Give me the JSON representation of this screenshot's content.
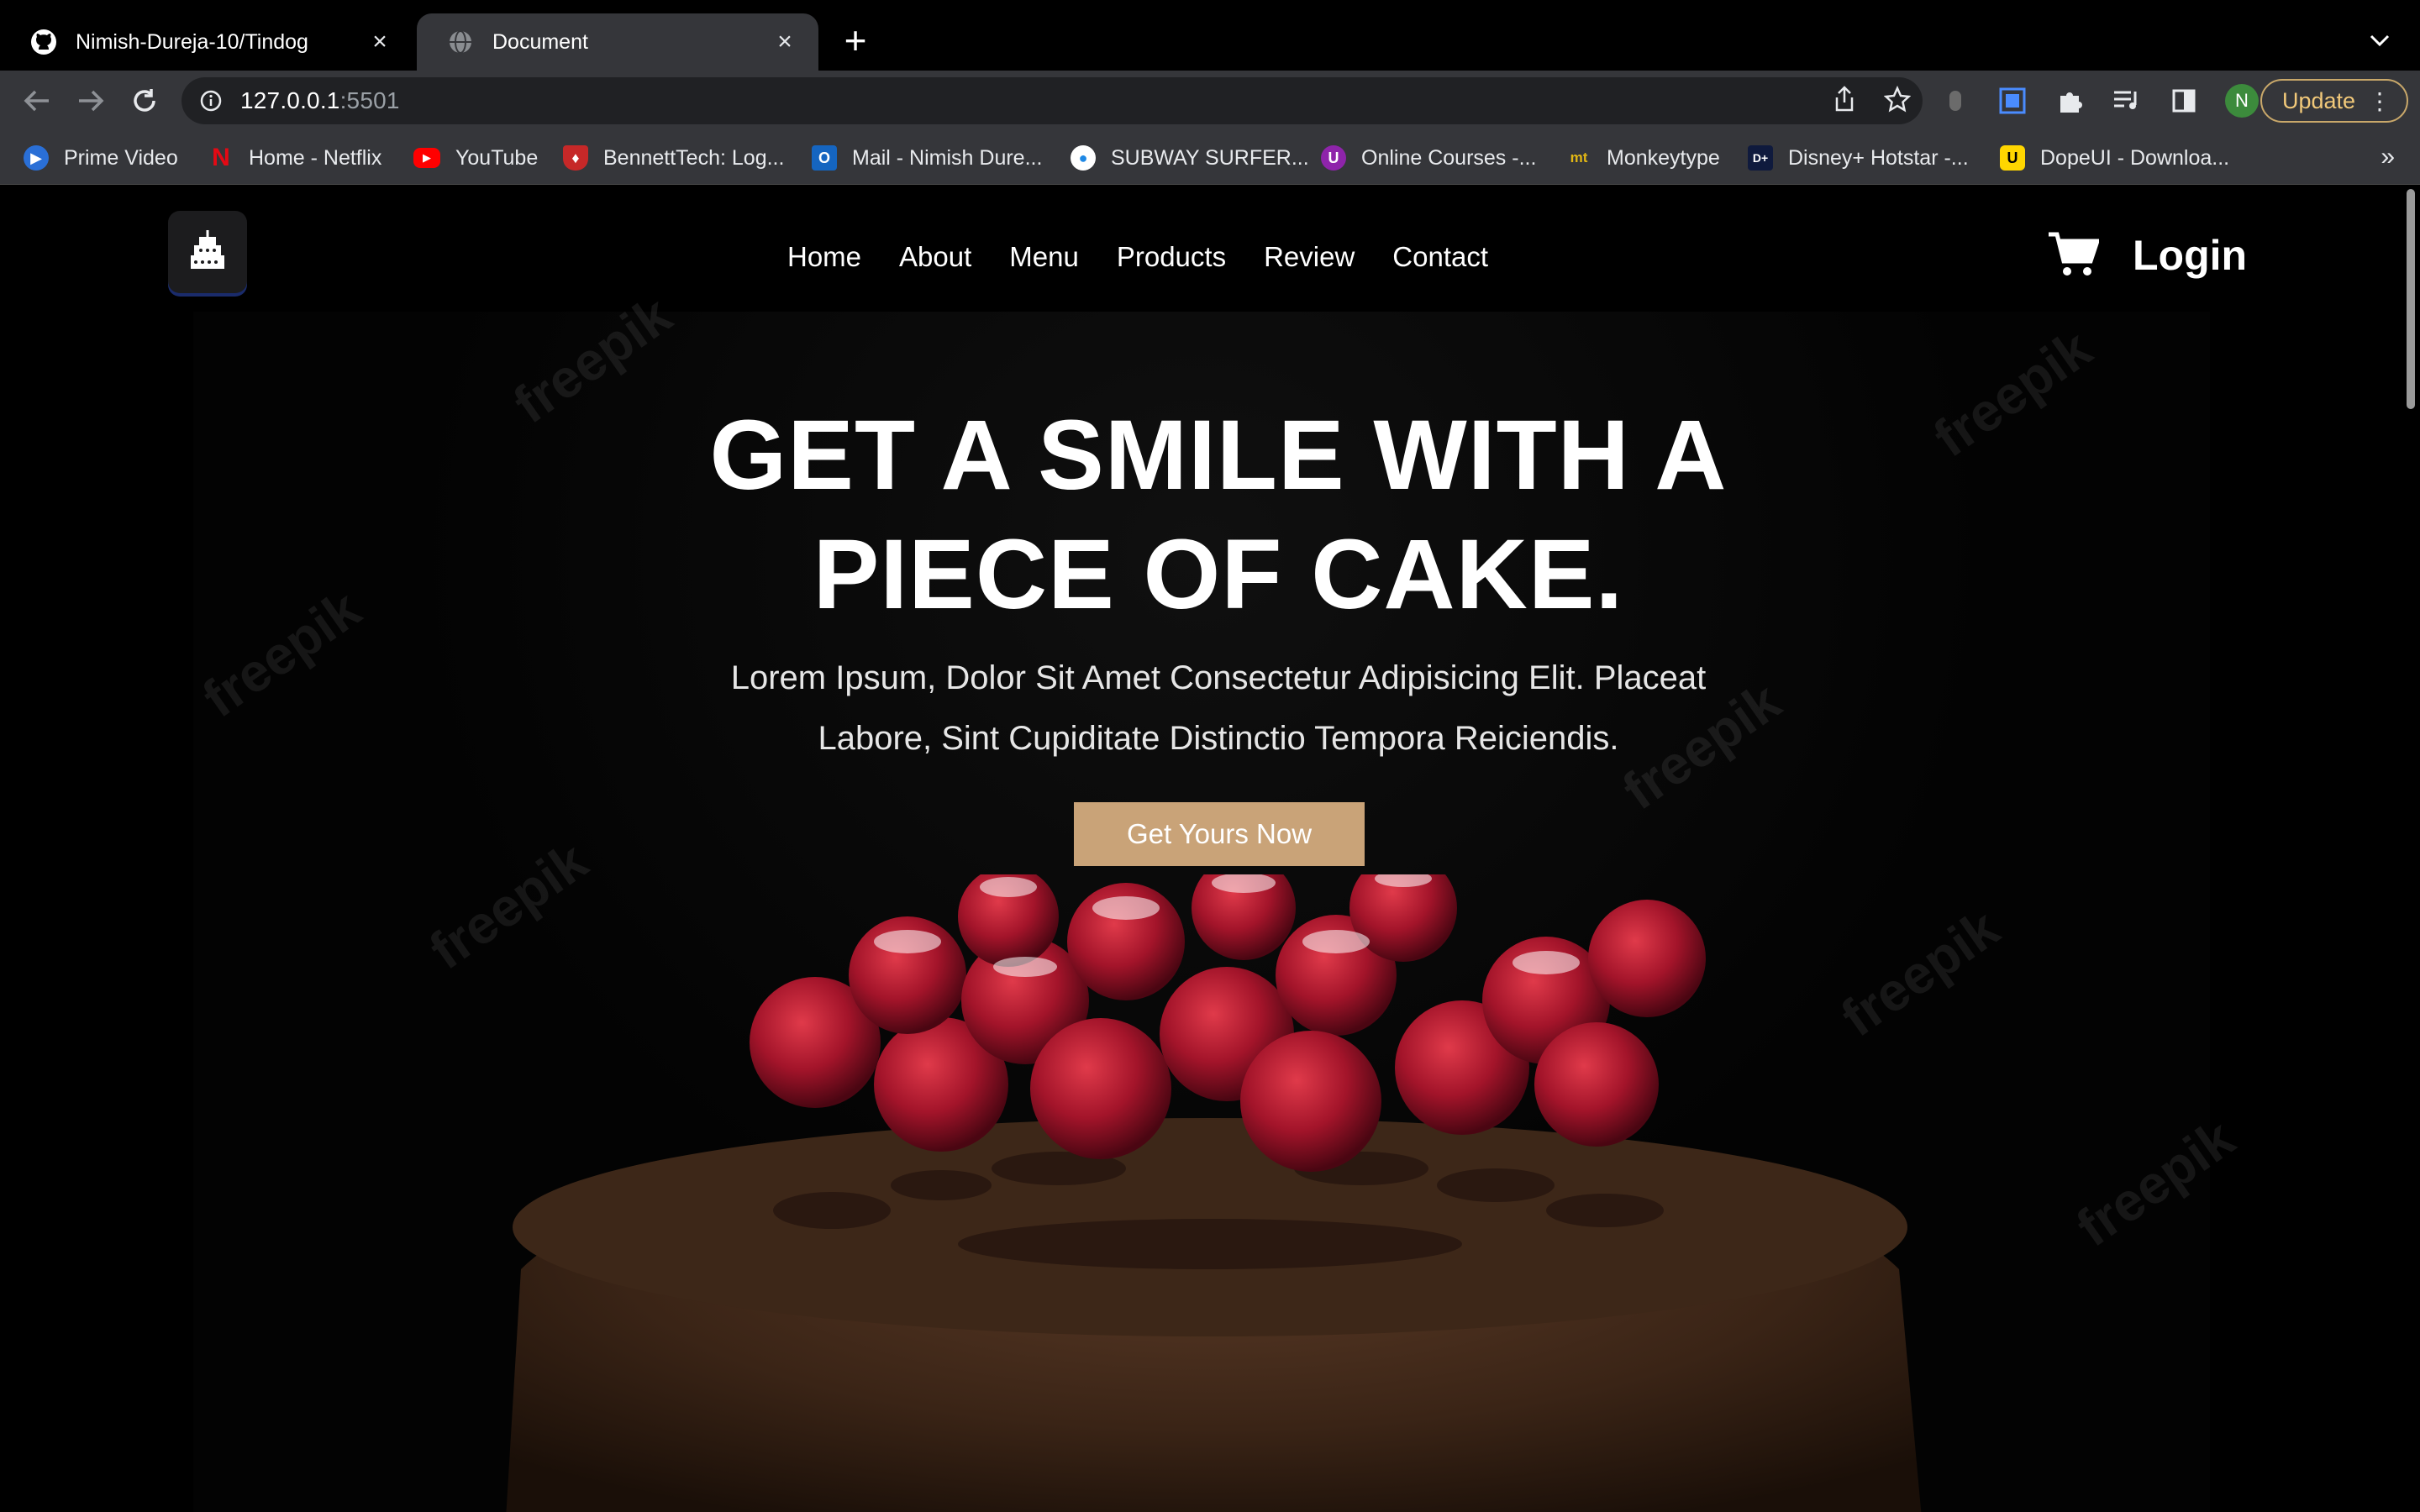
{
  "browser": {
    "tabs": [
      {
        "title": "Nimish-Dureja-10/Tindog",
        "icon": "github-icon",
        "active": false
      },
      {
        "title": "Document",
        "icon": "globe-icon",
        "active": true
      }
    ],
    "url_host": "127.0.0.1",
    "url_port": ":5501",
    "profile_initial": "N",
    "update_label": "Update",
    "bookmarks": [
      {
        "label": "Prime Video",
        "icon": "prime-video-icon"
      },
      {
        "label": "Home - Netflix",
        "icon": "netflix-icon"
      },
      {
        "label": "YouTube",
        "icon": "youtube-icon"
      },
      {
        "label": "BennettTech: Log...",
        "icon": "bennett-icon"
      },
      {
        "label": "Mail - Nimish Dure...",
        "icon": "outlook-icon"
      },
      {
        "label": "SUBWAY SURFER...",
        "icon": "subway-icon"
      },
      {
        "label": "Online Courses -...",
        "icon": "udemy-icon"
      },
      {
        "label": "Monkeytype",
        "icon": "monkeytype-icon"
      },
      {
        "label": "Disney+ Hotstar -...",
        "icon": "hotstar-icon"
      },
      {
        "label": "DopeUI - Downloa...",
        "icon": "dopeui-icon"
      }
    ],
    "bookmarks_overflow": "»"
  },
  "site": {
    "nav": [
      "Home",
      "About",
      "Menu",
      "Products",
      "Review",
      "Contact"
    ],
    "login": "Login",
    "headline_line1": "GET A SMILE WITH A",
    "headline_line2": "PIECE OF CAKE.",
    "subtext": "Lorem Ipsum, Dolor Sit Amet Consectetur Adipisicing Elit. Placeat Labore, Sint Cupiditate Distinctio Tempora Reiciendis.",
    "cta": "Get Yours Now",
    "watermark": "freepik",
    "accent_color": "#c9a378"
  }
}
